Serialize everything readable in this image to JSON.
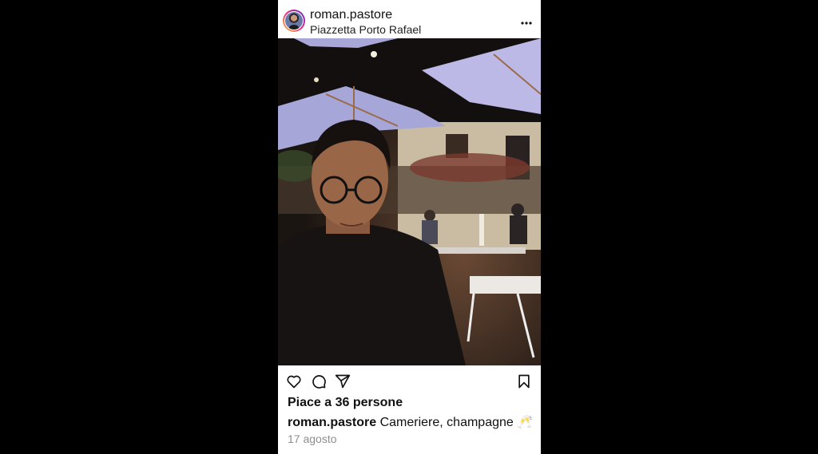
{
  "post": {
    "username": "roman.pastore",
    "location": "Piazzetta Porto Rafael",
    "more_icon": "more-horizontal-icon",
    "likes_text": "Piace a 36 persone",
    "caption_user": "roman.pastore",
    "caption_text": "Cameriere, champagne 🥂",
    "date": "17 agosto",
    "actions": [
      "heart-icon",
      "comment-icon",
      "share-icon",
      "bookmark-icon"
    ]
  }
}
